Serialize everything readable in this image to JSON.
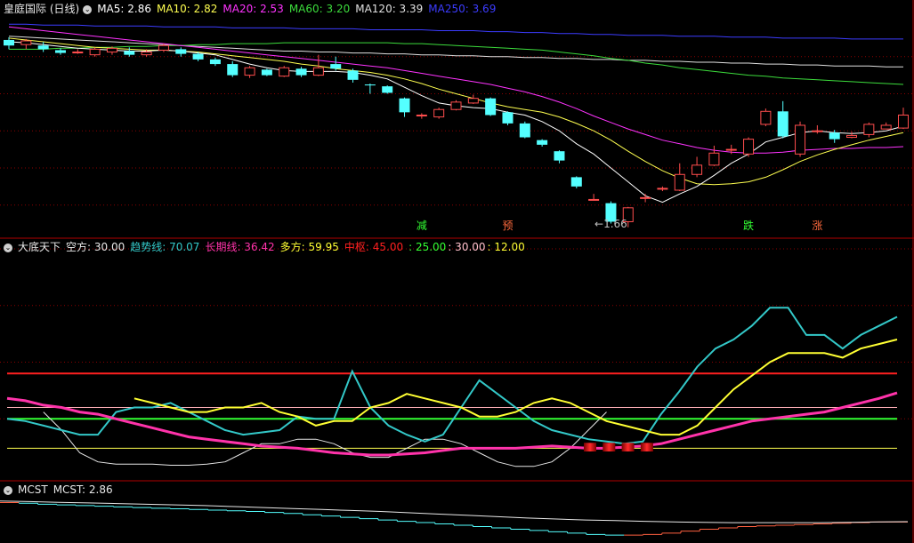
{
  "colors": {
    "up": "#ff4d4d",
    "down": "#54ffff",
    "ma5": "#ffffff",
    "ma10": "#ffff50",
    "ma20": "#ff33ff",
    "ma60": "#3cdc3c",
    "ma120": "#e0e0e0",
    "ma250": "#3c3cff",
    "trend": "#33c8c8",
    "long": "#ff33aa",
    "bull": "#ffff33",
    "red": "#ff2020",
    "green": "#33ff33",
    "grid": "#8b0000"
  },
  "header": {
    "title": "皇庭国际 (日线)",
    "ma5": "MA5: 2.86",
    "ma10": "MA10: 2.82",
    "ma20": "MA20: 2.53",
    "ma60": "MA60: 3.20",
    "ma120": "MA120: 3.39",
    "ma250": "MA250: 3.69"
  },
  "ind_header": {
    "title": "大底天下",
    "bear": "空方: 30.00",
    "trend": "趋势线: 70.07",
    "long": "长期线: 36.42",
    "bull": "多方: 59.95",
    "mid": "中枢: 45.00",
    "lvl25": ": 25.00",
    "lvl30": ": 30.00",
    "lvl12": ": 12.00"
  },
  "mcst_header": {
    "title": "MCST",
    "value": "MCST: 2.86"
  },
  "chart_data": [
    {
      "type": "candlestick",
      "annotations": [
        {
          "label": "←1.66",
          "index": 35
        },
        {
          "label": "减",
          "index": 24
        },
        {
          "label": "预",
          "index": 29
        },
        {
          "label": "跌",
          "index": 43
        },
        {
          "label": "涨",
          "index": 47
        }
      ],
      "candles": [
        [
          3.68,
          3.62,
          3.71,
          3.58
        ],
        [
          3.63,
          3.67,
          3.69,
          3.58
        ],
        [
          3.62,
          3.58,
          3.66,
          3.55
        ],
        [
          3.57,
          3.54,
          3.59,
          3.52
        ],
        [
          3.55,
          3.55,
          3.58,
          3.53
        ],
        [
          3.52,
          3.58,
          3.6,
          3.5
        ],
        [
          3.55,
          3.59,
          3.61,
          3.52
        ],
        [
          3.56,
          3.52,
          3.6,
          3.5
        ],
        [
          3.52,
          3.55,
          3.58,
          3.5
        ],
        [
          3.57,
          3.62,
          3.64,
          3.55
        ],
        [
          3.58,
          3.53,
          3.6,
          3.5
        ],
        [
          3.53,
          3.47,
          3.55,
          3.45
        ],
        [
          3.47,
          3.42,
          3.49,
          3.4
        ],
        [
          3.42,
          3.3,
          3.45,
          3.28
        ],
        [
          3.3,
          3.38,
          3.4,
          3.27
        ],
        [
          3.36,
          3.3,
          3.37,
          3.29
        ],
        [
          3.29,
          3.38,
          3.4,
          3.28
        ],
        [
          3.37,
          3.3,
          3.39,
          3.28
        ],
        [
          3.3,
          3.38,
          3.52,
          3.29
        ],
        [
          3.42,
          3.37,
          3.5,
          3.35
        ],
        [
          3.35,
          3.25,
          3.37,
          3.22
        ],
        [
          3.2,
          3.19,
          3.21,
          3.1
        ],
        [
          3.18,
          3.11,
          3.19,
          3.1
        ],
        [
          3.05,
          2.9,
          3.06,
          2.85
        ],
        [
          2.87,
          2.87,
          2.89,
          2.83
        ],
        [
          2.85,
          2.93,
          2.95,
          2.83
        ],
        [
          2.93,
          3.01,
          3.03,
          2.92
        ],
        [
          3.0,
          3.05,
          3.09,
          2.99
        ],
        [
          3.05,
          2.87,
          3.06,
          2.86
        ],
        [
          2.9,
          2.78,
          2.91,
          2.76
        ],
        [
          2.78,
          2.63,
          2.8,
          2.62
        ],
        [
          2.6,
          2.55,
          2.61,
          2.53
        ],
        [
          2.48,
          2.38,
          2.49,
          2.35
        ],
        [
          2.2,
          2.1,
          2.21,
          2.08
        ],
        [
          1.96,
          1.96,
          2.02,
          1.95
        ],
        [
          1.92,
          1.72,
          1.94,
          1.7
        ],
        [
          1.72,
          1.87,
          1.88,
          1.66
        ],
        [
          1.98,
          1.98,
          2.02,
          1.93
        ],
        [
          2.08,
          2.08,
          2.1,
          2.05
        ],
        [
          2.06,
          2.23,
          2.35,
          2.05
        ],
        [
          2.23,
          2.33,
          2.42,
          2.2
        ],
        [
          2.33,
          2.46,
          2.54,
          2.32
        ],
        [
          2.5,
          2.5,
          2.55,
          2.45
        ],
        [
          2.45,
          2.61,
          2.63,
          2.42
        ],
        [
          2.77,
          2.91,
          2.94,
          2.75
        ],
        [
          2.91,
          2.64,
          3.02,
          2.62
        ],
        [
          2.45,
          2.76,
          2.8,
          2.42
        ],
        [
          2.7,
          2.7,
          2.76,
          2.67
        ],
        [
          2.68,
          2.61,
          2.71,
          2.57
        ],
        [
          2.63,
          2.65,
          2.69,
          2.62
        ],
        [
          2.66,
          2.77,
          2.79,
          2.63
        ],
        [
          2.72,
          2.76,
          2.79,
          2.72
        ],
        [
          2.73,
          2.87,
          2.95,
          2.72
        ]
      ],
      "ma5": [
        3.66,
        3.65,
        3.63,
        3.61,
        3.59,
        3.58,
        3.57,
        3.56,
        3.56,
        3.57,
        3.56,
        3.54,
        3.52,
        3.47,
        3.42,
        3.38,
        3.35,
        3.34,
        3.34,
        3.34,
        3.33,
        3.3,
        3.26,
        3.17,
        3.08,
        3.0,
        2.97,
        2.95,
        2.94,
        2.9,
        2.87,
        2.8,
        2.7,
        2.56,
        2.45,
        2.3,
        2.15,
        2.0,
        1.93,
        2.02,
        2.1,
        2.22,
        2.35,
        2.45,
        2.58,
        2.63,
        2.68,
        2.7,
        2.68,
        2.67,
        2.68,
        2.7,
        2.75
      ],
      "ma10": [
        3.7,
        3.68,
        3.66,
        3.64,
        3.62,
        3.6,
        3.59,
        3.58,
        3.57,
        3.57,
        3.56,
        3.55,
        3.53,
        3.51,
        3.49,
        3.47,
        3.45,
        3.42,
        3.4,
        3.37,
        3.35,
        3.33,
        3.3,
        3.26,
        3.21,
        3.15,
        3.1,
        3.05,
        3.0,
        2.96,
        2.93,
        2.9,
        2.85,
        2.78,
        2.7,
        2.6,
        2.48,
        2.37,
        2.27,
        2.19,
        2.13,
        2.12,
        2.13,
        2.15,
        2.2,
        2.28,
        2.37,
        2.44,
        2.5,
        2.55,
        2.6,
        2.64,
        2.68
      ],
      "ma20": [
        3.82,
        3.8,
        3.78,
        3.76,
        3.74,
        3.72,
        3.7,
        3.68,
        3.66,
        3.64,
        3.62,
        3.6,
        3.58,
        3.56,
        3.54,
        3.52,
        3.5,
        3.48,
        3.46,
        3.44,
        3.42,
        3.4,
        3.38,
        3.35,
        3.32,
        3.29,
        3.26,
        3.23,
        3.2,
        3.16,
        3.12,
        3.07,
        3.01,
        2.94,
        2.86,
        2.79,
        2.72,
        2.66,
        2.6,
        2.56,
        2.52,
        2.49,
        2.47,
        2.46,
        2.46,
        2.47,
        2.49,
        2.5,
        2.51,
        2.51,
        2.52,
        2.52,
        2.53
      ],
      "ma60": [
        3.58,
        3.58,
        3.58,
        3.59,
        3.59,
        3.6,
        3.6,
        3.61,
        3.61,
        3.62,
        3.62,
        3.63,
        3.63,
        3.64,
        3.64,
        3.64,
        3.65,
        3.65,
        3.65,
        3.65,
        3.65,
        3.65,
        3.65,
        3.64,
        3.64,
        3.63,
        3.62,
        3.61,
        3.6,
        3.59,
        3.58,
        3.57,
        3.55,
        3.53,
        3.51,
        3.48,
        3.46,
        3.43,
        3.41,
        3.38,
        3.36,
        3.34,
        3.32,
        3.3,
        3.29,
        3.27,
        3.26,
        3.25,
        3.24,
        3.23,
        3.22,
        3.21,
        3.2
      ],
      "ma120": [
        3.72,
        3.71,
        3.7,
        3.69,
        3.68,
        3.67,
        3.66,
        3.65,
        3.64,
        3.63,
        3.62,
        3.61,
        3.6,
        3.59,
        3.58,
        3.57,
        3.56,
        3.56,
        3.55,
        3.55,
        3.54,
        3.54,
        3.53,
        3.53,
        3.52,
        3.52,
        3.51,
        3.51,
        3.5,
        3.5,
        3.49,
        3.49,
        3.48,
        3.48,
        3.47,
        3.47,
        3.46,
        3.46,
        3.45,
        3.45,
        3.44,
        3.44,
        3.43,
        3.43,
        3.42,
        3.42,
        3.41,
        3.41,
        3.4,
        3.4,
        3.4,
        3.39,
        3.39
      ],
      "ma250": [
        3.85,
        3.85,
        3.84,
        3.84,
        3.84,
        3.83,
        3.83,
        3.83,
        3.83,
        3.82,
        3.82,
        3.82,
        3.82,
        3.81,
        3.81,
        3.81,
        3.81,
        3.8,
        3.8,
        3.8,
        3.8,
        3.79,
        3.79,
        3.79,
        3.79,
        3.78,
        3.78,
        3.78,
        3.77,
        3.77,
        3.76,
        3.76,
        3.75,
        3.75,
        3.74,
        3.74,
        3.73,
        3.73,
        3.73,
        3.72,
        3.72,
        3.72,
        3.71,
        3.71,
        3.71,
        3.7,
        3.7,
        3.7,
        3.7,
        3.69,
        3.69,
        3.69,
        3.69
      ]
    },
    {
      "type": "line",
      "ylim": [
        0,
        100
      ],
      "levels": [
        {
          "value": 45,
          "color": "red"
        },
        {
          "value": 30,
          "color": "pink"
        },
        {
          "value": 25,
          "color": "green"
        },
        {
          "value": 12,
          "color": "yellow"
        }
      ],
      "trend": [
        25,
        24,
        22,
        20,
        18,
        18,
        28,
        30,
        30,
        32,
        28,
        24,
        20,
        18,
        19,
        20,
        26,
        25,
        25,
        46,
        30,
        22,
        18,
        15,
        18,
        30,
        42,
        36,
        30,
        24,
        20,
        18,
        16,
        15,
        14,
        15,
        27,
        37,
        48,
        56,
        60,
        66,
        74,
        74,
        62,
        62,
        56,
        62,
        66,
        70
      ],
      "long": [
        34,
        33,
        31,
        30,
        28,
        27,
        25,
        23,
        21,
        19,
        17,
        16,
        15,
        14,
        13,
        12.5,
        12,
        11,
        10,
        9.5,
        9,
        9,
        9.5,
        10,
        11,
        12,
        12,
        12,
        12,
        12.5,
        13,
        12.5,
        12,
        12,
        12.5,
        13,
        14,
        16,
        18,
        20,
        22,
        24,
        25,
        26,
        27,
        28,
        30,
        32,
        34,
        36.42
      ],
      "bull": [
        34,
        32,
        30,
        28,
        28,
        30,
        30,
        32,
        28,
        26,
        22,
        24,
        24,
        30,
        32,
        36,
        34,
        32,
        30,
        26,
        26,
        28,
        32,
        34,
        32,
        28,
        24,
        22,
        20,
        18,
        18,
        22,
        30,
        38,
        44,
        50,
        54,
        54,
        54,
        52,
        56,
        58,
        60
      ],
      "bull_x0": 7,
      "white": [
        28,
        20,
        10,
        6,
        5,
        5,
        5,
        4.5,
        4.5,
        5,
        6,
        10,
        14,
        14,
        16,
        16,
        14,
        10,
        8,
        8,
        12,
        16,
        16,
        14,
        10,
        6,
        4,
        4,
        6,
        12,
        20,
        28
      ],
      "white_x0": 2,
      "sticks": [
        {
          "index": 30,
          "value": 14
        },
        {
          "index": 31,
          "value": 14
        },
        {
          "index": 32,
          "value": 14
        },
        {
          "index": 33,
          "value": 14
        }
      ]
    },
    {
      "type": "step",
      "series": [
        3.45,
        3.43,
        3.4,
        3.38,
        3.36,
        3.34,
        3.32,
        3.3,
        3.28,
        3.26,
        3.24,
        3.22,
        3.2,
        3.18,
        3.15,
        3.12,
        3.08,
        3.04,
        3.0,
        2.96,
        2.92,
        2.88,
        2.84,
        2.8,
        2.76,
        2.72,
        2.68,
        2.64,
        2.6,
        2.56,
        2.52,
        2.48,
        2.46,
        2.46,
        2.48,
        2.52,
        2.58,
        2.64,
        2.68,
        2.72,
        2.74,
        2.76,
        2.78,
        2.8,
        2.82,
        2.84,
        2.86,
        2.86
      ],
      "avg": [
        3.5,
        3.48,
        3.46,
        3.44,
        3.42,
        3.4,
        3.38,
        3.36,
        3.33,
        3.3,
        3.27,
        3.24,
        3.21,
        3.18,
        3.14,
        3.1,
        3.06,
        3.02,
        2.98,
        2.95,
        2.92,
        2.9,
        2.88,
        2.86,
        2.85,
        2.84,
        2.84,
        2.84,
        2.84,
        2.85,
        2.86,
        2.87
      ],
      "ylim": [
        2.3,
        3.6
      ]
    }
  ]
}
